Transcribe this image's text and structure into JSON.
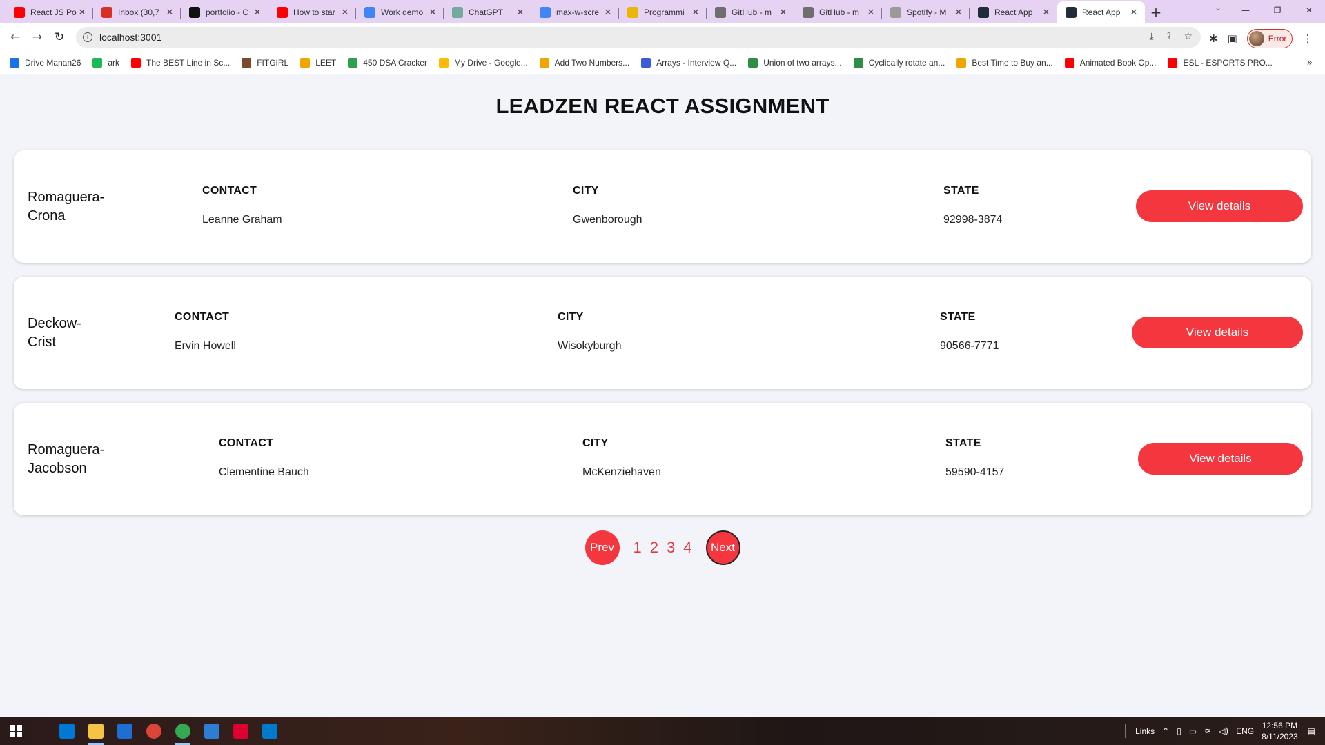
{
  "browser": {
    "tabs": [
      {
        "label": "React JS Po",
        "icon": "youtube-icon",
        "color": "#ff0000"
      },
      {
        "label": "Inbox (30,7",
        "icon": "gmail-icon",
        "color": "#d93025"
      },
      {
        "label": "portfolio - C",
        "icon": "codepen-icon",
        "color": "#111111"
      },
      {
        "label": "How to star",
        "icon": "youtube-icon",
        "color": "#ff0000"
      },
      {
        "label": "Work demo",
        "icon": "google-icon",
        "color": "#4285f4"
      },
      {
        "label": "ChatGPT",
        "icon": "chatgpt-icon",
        "color": "#74aa9c"
      },
      {
        "label": "max-w-scre",
        "icon": "google-icon",
        "color": "#4285f4"
      },
      {
        "label": "Programmi",
        "icon": "tm-icon",
        "color": "#e9b600"
      },
      {
        "label": "GitHub - m",
        "icon": "github-icon",
        "color": "#6e6e6e"
      },
      {
        "label": "GitHub - m",
        "icon": "github-icon",
        "color": "#6e6e6e"
      },
      {
        "label": "Spotify - M",
        "icon": "globe-icon",
        "color": "#9a9a9a"
      },
      {
        "label": "React App",
        "icon": "react-icon",
        "color": "#222d3a"
      },
      {
        "label": "React App",
        "icon": "react-icon",
        "color": "#222d3a",
        "active": true
      }
    ],
    "url": "localhost:3001",
    "profile_label": "Error",
    "bookmarks": [
      {
        "label": "Drive Manan26",
        "color": "#1a73e8"
      },
      {
        "label": "ark",
        "color": "#1db954"
      },
      {
        "label": "The BEST Line in Sc...",
        "color": "#ff0000"
      },
      {
        "label": "FITGIRL",
        "color": "#7a4a2a"
      },
      {
        "label": "LEET",
        "color": "#f0a500"
      },
      {
        "label": "450 DSA Cracker",
        "color": "#2e9e4f"
      },
      {
        "label": "My Drive - Google...",
        "color": "#fbbc04"
      },
      {
        "label": "Add Two Numbers...",
        "color": "#f0a500"
      },
      {
        "label": "Arrays - Interview Q...",
        "color": "#3b5bdb"
      },
      {
        "label": "Union of two arrays...",
        "color": "#2f8d46"
      },
      {
        "label": "Cyclically rotate an...",
        "color": "#2f8d46"
      },
      {
        "label": "Best Time to Buy an...",
        "color": "#f0a500"
      },
      {
        "label": "Animated Book Op...",
        "color": "#ff0000"
      },
      {
        "label": "ESL - ESPORTS PRO...",
        "color": "#ff0000"
      }
    ]
  },
  "page": {
    "title": "LEADZEN REACT ASSIGNMENT",
    "cards": [
      {
        "company_line1": "Romaguera-",
        "company_line2": "Crona",
        "contact_header": "CONTACT",
        "contact": "Leanne Graham",
        "city_header": "CITY",
        "city": "Gwenborough",
        "state_header": "STATE",
        "state": "92998-3874",
        "button": "View details"
      },
      {
        "company_line1": "Deckow-",
        "company_line2": "Crist",
        "contact_header": "CONTACT",
        "contact": "Ervin Howell",
        "city_header": "CITY",
        "city": "Wisokyburgh",
        "state_header": "STATE",
        "state": "90566-7771",
        "button": "View details"
      },
      {
        "company_line1": "Romaguera-",
        "company_line2": "Jacobson",
        "contact_header": "CONTACT",
        "contact": "Clementine Bauch",
        "city_header": "CITY",
        "city": "McKenziehaven",
        "state_header": "STATE",
        "state": "59590-4157",
        "button": "View details"
      }
    ],
    "pagination": {
      "prev": "Prev",
      "pages": [
        "1",
        "2",
        "3",
        "4"
      ],
      "next": "Next"
    },
    "accent_color": "#f4373e"
  },
  "taskbar": {
    "apps": [
      {
        "name": "store-icon",
        "color": "#0078d4"
      },
      {
        "name": "file-explorer-icon",
        "color": "#f4c542"
      },
      {
        "name": "mail-icon",
        "color": "#1d6fd1"
      },
      {
        "name": "chrome-icon",
        "color": "#db4437"
      },
      {
        "name": "chrome-profile-icon",
        "color": "#34a853"
      },
      {
        "name": "photos-icon",
        "color": "#2d7dd2"
      },
      {
        "name": "angular-icon",
        "color": "#dd0031"
      },
      {
        "name": "vscode-icon",
        "color": "#007acc"
      }
    ],
    "tray_label": "Links",
    "language": "ENG",
    "time": "12:56 PM",
    "date": "8/11/2023"
  }
}
